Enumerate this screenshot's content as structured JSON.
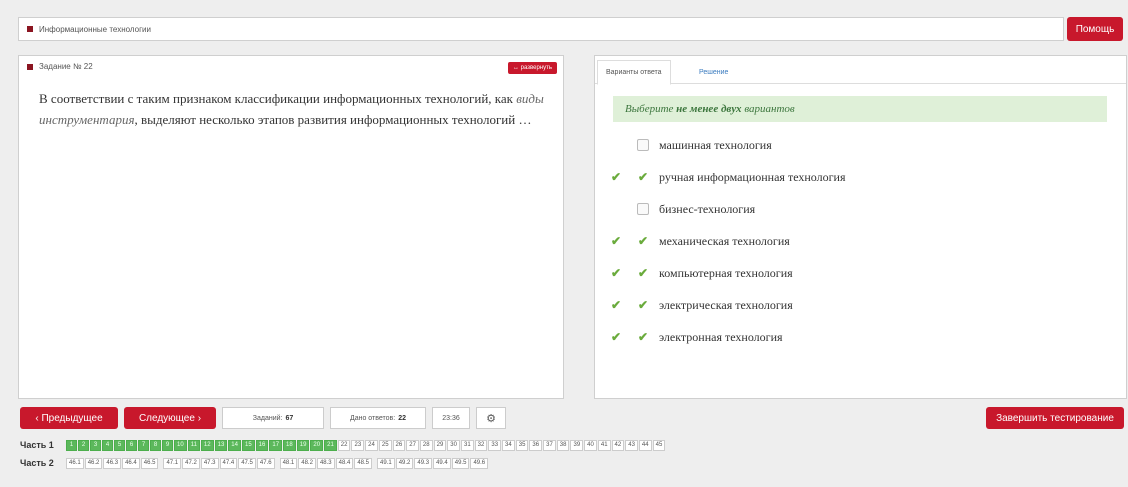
{
  "header": {
    "subject": "Информационные технологии",
    "help_label": "Помощь"
  },
  "question": {
    "title": "Задание № 22",
    "expand_label": "↔ развернуть",
    "text_before": "В соответствии с таким признаком классификации информационных технологий, как ",
    "text_emph": "виды инструментария",
    "text_after": ", выделяют несколько этапов развития информационных технологий …"
  },
  "answers": {
    "tabs": [
      "Варианты ответа",
      "Решение"
    ],
    "hint_before": "Выберите ",
    "hint_bold": "не менее двух",
    "hint_after": " вариантов",
    "options": [
      {
        "label": "машинная технология",
        "checked": false,
        "correct": false
      },
      {
        "label": "ручная информационная технология",
        "checked": true,
        "correct": true
      },
      {
        "label": "бизнес-технология",
        "checked": false,
        "correct": false
      },
      {
        "label": "механическая технология",
        "checked": true,
        "correct": true
      },
      {
        "label": "компьютерная технология",
        "checked": true,
        "correct": true
      },
      {
        "label": "электрическая технология",
        "checked": true,
        "correct": true
      },
      {
        "label": "электронная технология",
        "checked": true,
        "correct": true
      }
    ]
  },
  "footer": {
    "prev_label": "‹ Предыдущее",
    "next_label": "Следующее ›",
    "tasks_label": "Заданий:",
    "tasks_value": "67",
    "answered_label": "Дано ответов:",
    "answered_value": "22",
    "timer": "23:36",
    "settings_icon": "gear-icon",
    "finish_label": "Завершить тестирование"
  },
  "parts": {
    "part1_label": "Часть 1",
    "part1_done": [
      "1",
      "2",
      "3",
      "4",
      "5",
      "6",
      "7",
      "8",
      "9",
      "10",
      "11",
      "12",
      "13",
      "14",
      "15",
      "16",
      "17",
      "18",
      "19",
      "20",
      "21"
    ],
    "part1_rest": [
      "22",
      "23",
      "24",
      "25",
      "26",
      "27",
      "28",
      "29",
      "30",
      "31",
      "32",
      "33",
      "34",
      "35",
      "36",
      "37",
      "38",
      "39",
      "40",
      "41",
      "42",
      "43",
      "44",
      "45"
    ],
    "part2_label": "Часть 2",
    "part2_groups": [
      [
        "46.1",
        "46.2",
        "46.3",
        "46.4",
        "46.5"
      ],
      [
        "47.1",
        "47.2",
        "47.3",
        "47.4",
        "47.5",
        "47.6"
      ],
      [
        "48.1",
        "48.2",
        "48.3",
        "48.4",
        "48.5"
      ],
      [
        "49.1",
        "49.2",
        "49.3",
        "49.4",
        "49.5",
        "49.6"
      ]
    ]
  },
  "colors": {
    "accent": "#c8182c",
    "done": "#5cb85c",
    "hint_bg": "#dff0d8",
    "check": "#6aab3c"
  }
}
